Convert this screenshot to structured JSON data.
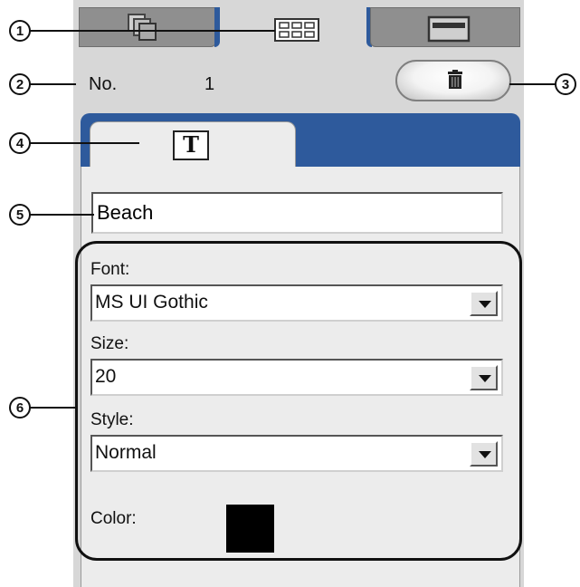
{
  "callouts": {
    "c1": "1",
    "c2": "2",
    "c3": "3",
    "c4": "4",
    "c5": "5",
    "c6": "6"
  },
  "record": {
    "no_label": "No.",
    "no_value": "1"
  },
  "text_input": {
    "value": "Beach"
  },
  "text_tab": {
    "glyph": "T"
  },
  "font": {
    "label": "Font:",
    "value": "MS UI Gothic"
  },
  "size": {
    "label": "Size:",
    "value": "20"
  },
  "style": {
    "label": "Style:",
    "value": "Normal"
  },
  "color": {
    "label": "Color:",
    "swatch": "#000000"
  },
  "icons": {
    "tab_left": "pages-icon",
    "tab_mid": "grid-icon",
    "tab_right": "window-icon",
    "delete": "trash-icon",
    "text_tab": "text-icon",
    "dropdown": "chevron-down-icon"
  },
  "colors": {
    "accent": "#2e5a9c",
    "panel": "#d7d7d7",
    "content": "#ececec"
  }
}
